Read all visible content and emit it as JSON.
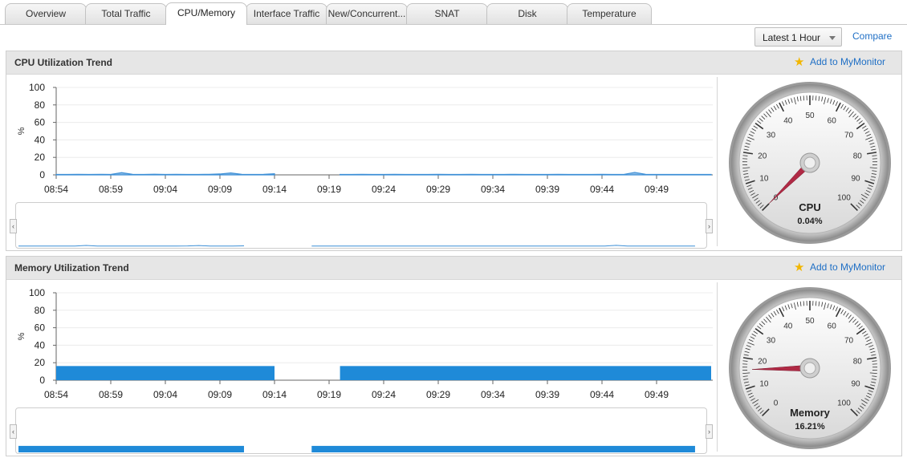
{
  "tabs": [
    {
      "label": "Overview",
      "active": false
    },
    {
      "label": "Total Traffic",
      "active": false
    },
    {
      "label": "CPU/Memory",
      "active": true
    },
    {
      "label": "Interface Traffic",
      "active": false
    },
    {
      "label": "New/Concurrent...",
      "active": false
    },
    {
      "label": "SNAT",
      "active": false
    },
    {
      "label": "Disk",
      "active": false
    },
    {
      "label": "Temperature",
      "active": false
    }
  ],
  "toolbar": {
    "range_label": "Latest 1 Hour",
    "compare_label": "Compare"
  },
  "panels": {
    "cpu": {
      "title": "CPU Utilization Trend",
      "mymonitor_label": "Add to MyMonitor"
    },
    "memory": {
      "title": "Memory Utilization Trend",
      "mymonitor_label": "Add to MyMonitor"
    }
  },
  "chart_data": [
    {
      "type": "area",
      "ylabel": "%",
      "ylim": [
        0,
        100
      ],
      "yticks": [
        "0",
        "20",
        "40",
        "60",
        "80",
        "100"
      ],
      "xticks": [
        "08:54",
        "08:59",
        "09:04",
        "09:09",
        "09:14",
        "09:19",
        "09:24",
        "09:29",
        "09:34",
        "09:39",
        "09:44",
        "09:49"
      ],
      "grid": true,
      "color": "#3d8fd6",
      "segments": [
        {
          "start": "08:54",
          "end": "09:14",
          "values": [
            0.5,
            0.5,
            0.6,
            0.5,
            0.6,
            0.5,
            2.5,
            0.6,
            0.5,
            0.7,
            0.5,
            0.6,
            0.5,
            0.5,
            0.6,
            1.0,
            2.2,
            0.6,
            0.5,
            0.6,
            1.2
          ]
        },
        {
          "start": "09:20",
          "end": "09:54",
          "values": [
            0.5,
            0.5,
            0.6,
            0.5,
            0.5,
            0.6,
            0.5,
            0.5,
            0.5,
            0.6,
            0.5,
            0.5,
            0.6,
            0.5,
            0.5,
            0.5,
            0.6,
            0.5,
            0.5,
            0.5,
            0.6,
            0.5,
            0.5,
            0.5,
            0.6,
            0.5,
            0.5,
            2.8,
            0.6,
            0.5,
            0.5,
            0.5,
            0.5,
            0.5,
            0.5
          ]
        }
      ]
    },
    {
      "type": "area",
      "ylabel": "%",
      "ylim": [
        0,
        100
      ],
      "yticks": [
        "0",
        "20",
        "40",
        "60",
        "80",
        "100"
      ],
      "xticks": [
        "08:54",
        "08:59",
        "09:04",
        "09:09",
        "09:14",
        "09:19",
        "09:24",
        "09:29",
        "09:34",
        "09:39",
        "09:44",
        "09:49"
      ],
      "grid": true,
      "color": "#1f8ad8",
      "segments": [
        {
          "start": "08:54",
          "end": "09:14",
          "values": [
            16.2,
            16.2
          ]
        },
        {
          "start": "09:20",
          "end": "09:54",
          "values": [
            16.2,
            16.2
          ]
        }
      ]
    }
  ],
  "gauges": {
    "cpu": {
      "label": "CPU",
      "value_text": "0.04%",
      "value": 0.04,
      "scale": [
        "0",
        "10",
        "20",
        "30",
        "40",
        "50",
        "60",
        "70",
        "80",
        "90",
        "100"
      ],
      "needle_color": "#b02a45"
    },
    "memory": {
      "label": "Memory",
      "value_text": "16.21%",
      "value": 16.21,
      "scale": [
        "0",
        "10",
        "20",
        "30",
        "40",
        "50",
        "60",
        "70",
        "80",
        "90",
        "100"
      ],
      "needle_color": "#b02a45"
    }
  }
}
